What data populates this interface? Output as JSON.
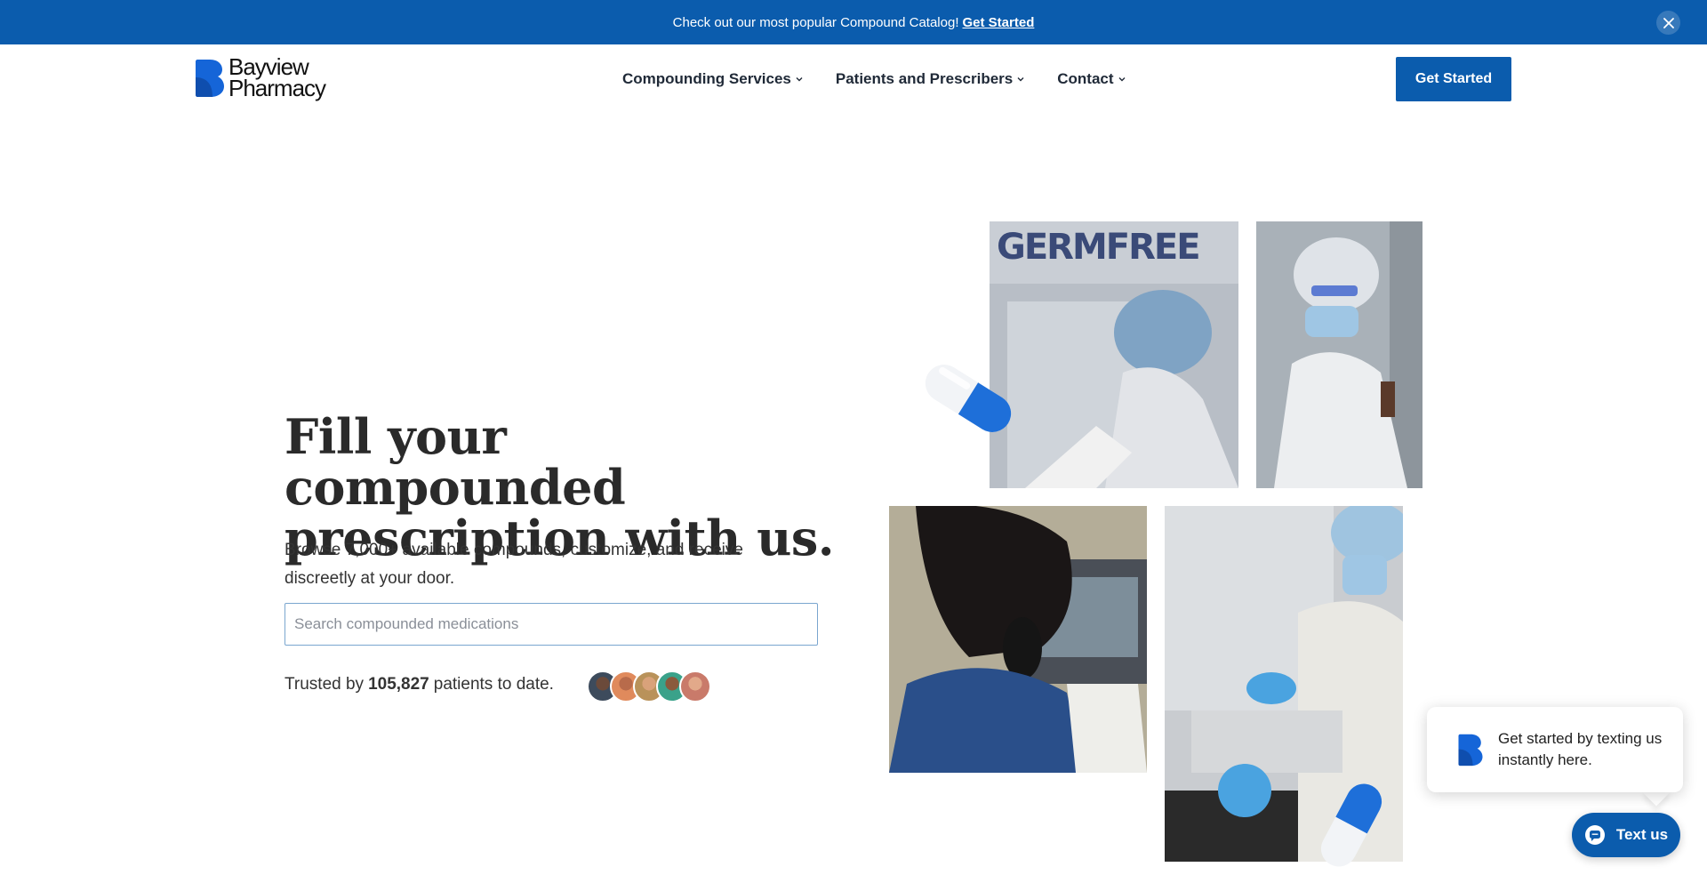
{
  "announcement": {
    "text": "Check out our most popular Compound Catalog!",
    "link_label": "Get Started",
    "close_icon": "close-icon"
  },
  "header": {
    "logo_text_line1": "Bayview",
    "logo_text_line2": "Pharmacy",
    "nav": [
      {
        "label": "Compounding Services"
      },
      {
        "label": "Patients and Prescribers"
      },
      {
        "label": "Contact"
      }
    ],
    "cta_label": "Get Started"
  },
  "hero": {
    "title": "Fill your compounded prescription with us.",
    "subtitle": "Browse 7,000+ available compounds, customize, and receive discreetly at your door.",
    "search_placeholder": "Search compounded medications",
    "search_value": "",
    "trusted_prefix": "Trusted by",
    "trusted_count": "105,827",
    "trusted_suffix": "patients to date.",
    "photo_sign_text": "GERMFREE"
  },
  "chat": {
    "message": "Get started by texting us instantly here.",
    "button_label": "Text us"
  },
  "colors": {
    "brand_blue": "#0b5cad",
    "logo_blue": "#1565d8",
    "text_dark": "#2a2a2a"
  }
}
